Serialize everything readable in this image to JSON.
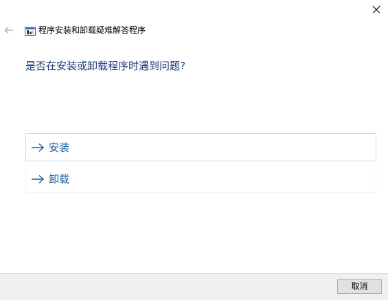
{
  "window": {
    "title": "程序安装和卸载疑难解答程序",
    "close_icon": "close-icon",
    "back_icon": "back-arrow-icon",
    "app_icon": "troubleshooter-app-icon"
  },
  "main": {
    "heading": "是否在安装或卸载程序时遇到问题?",
    "options": [
      {
        "label": "安装",
        "icon": "arrow-right-icon"
      },
      {
        "label": "卸载",
        "icon": "arrow-right-icon"
      }
    ]
  },
  "footer": {
    "cancel_label": "取消"
  },
  "colors": {
    "heading": "#1e3c78",
    "option_text": "#1a5fa0",
    "option_border_selected": "#c6dcec",
    "footer_bg": "#f0f0f0"
  }
}
